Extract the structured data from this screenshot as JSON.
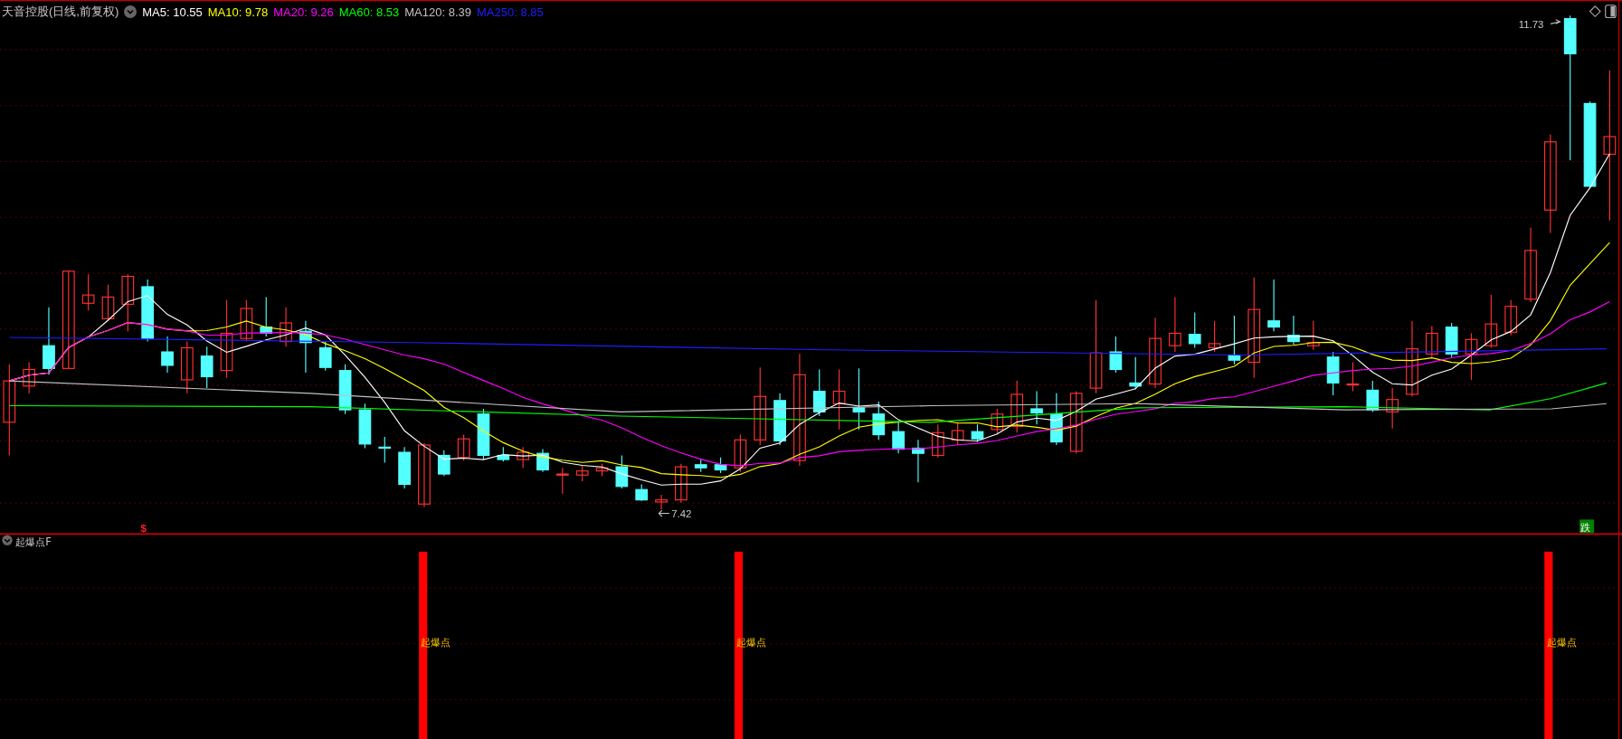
{
  "chart_title": "天音控股(日线,前复权)",
  "ma_legend": [
    {
      "label": "MA5: 10.55",
      "color": "#ffffff"
    },
    {
      "label": "MA10: 9.78",
      "color": "#ffff00"
    },
    {
      "label": "MA20: 9.26",
      "color": "#ff00ff"
    },
    {
      "label": "MA60: 8.53",
      "color": "#00ff00"
    },
    {
      "label": "MA120: 8.39",
      "color": "#c0c0c0"
    },
    {
      "label": "MA250: 8.85",
      "color": "#1e1eff"
    }
  ],
  "price_markers": {
    "high": "11.73",
    "low": "7.42"
  },
  "signal_marks": [
    {
      "kind": "dollar",
      "text": "$"
    },
    {
      "kind": "fall",
      "text": "跌"
    }
  ],
  "indicator_panel": {
    "name": "起爆点F",
    "signals": [
      {
        "label": "起爆点"
      },
      {
        "label": "起爆点"
      },
      {
        "label": "起爆点"
      }
    ]
  }
}
